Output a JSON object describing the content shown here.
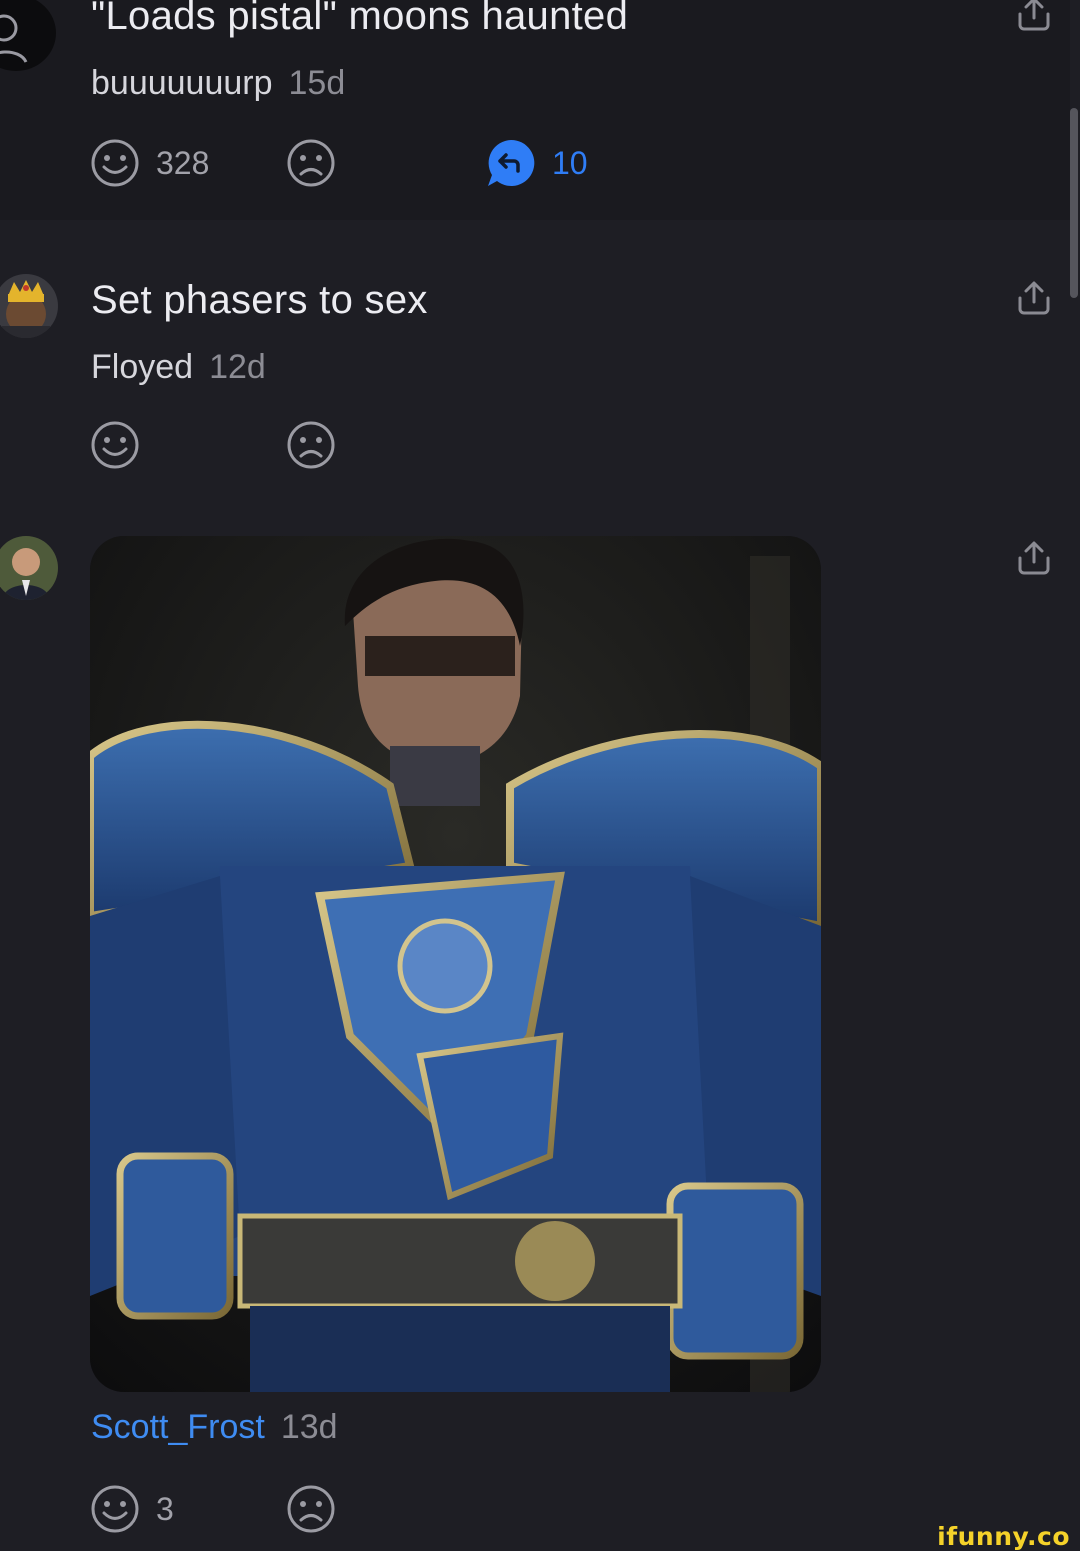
{
  "comments": [
    {
      "text": "\"Loads pistal\" moons haunted",
      "author": "buuuuuuurp",
      "age": "15d",
      "likes": "328",
      "replies": "10"
    },
    {
      "text": "Set phasers to sex",
      "author": "Floyed",
      "age": "12d"
    },
    {
      "author": "Scott_Frost",
      "age": "13d",
      "likes": "3",
      "image_description": "armored knight"
    }
  ],
  "icons": {
    "like": "smile-icon",
    "dislike": "frown-icon",
    "reply": "reply-bubble-icon",
    "share": "share-icon"
  },
  "colors": {
    "background": "#1e1e24",
    "highlight_bg": "#1a1a1f",
    "accent_blue": "#2f7df6",
    "link_blue": "#3f8cf2",
    "watermark_yellow": "#f5d22a"
  },
  "watermark": "ifunny.co"
}
